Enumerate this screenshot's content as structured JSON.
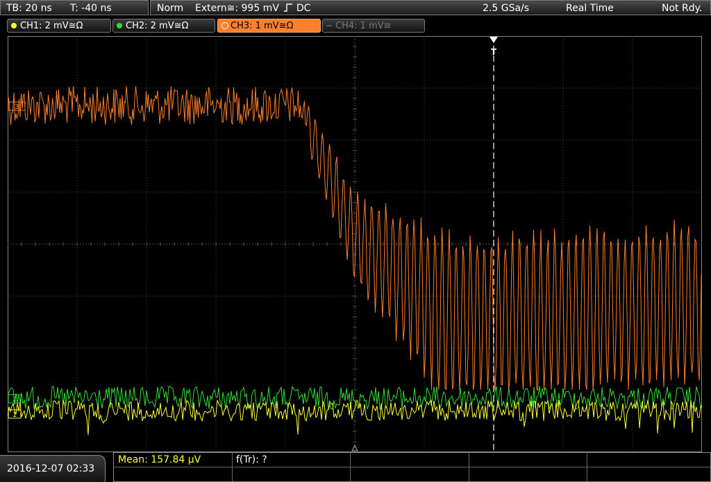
{
  "topbar": {
    "timebase": "TB: 20 ns",
    "trigger_time": "T: -40 ns",
    "mode": "Norm",
    "trigger_source": "Extern≅: 995 mV",
    "trigger_slope": "DC",
    "sample_rate": "2.5 GSa/s",
    "acq_mode": "Real Time",
    "status": "Not Rdy."
  },
  "channels": [
    {
      "label": "CH1: 2 mV≅Ω",
      "color": "#ffff33",
      "state": "on"
    },
    {
      "label": "CH2: 2 mV≅Ω",
      "color": "#33dd33",
      "state": "on"
    },
    {
      "label": "CH3: 1 mV≅Ω",
      "color": "#ff7f2a",
      "state": "active"
    },
    {
      "label": "CH4: 1 mV≅",
      "color": "#777777",
      "state": "off"
    }
  ],
  "screen": {
    "trigger_marker": "T",
    "ch3_marker": "3",
    "ch1_marker": "1",
    "ch2_marker": "2",
    "colors": {
      "grid": "#5a5a5a",
      "ch1": "#ffff33",
      "ch2": "#33dd33",
      "ch3": "#ff7f2a"
    }
  },
  "footer": {
    "datetime": "2016-12-07 02:33",
    "mean": "Mean: 157.84 µV",
    "ftr": "f(Tr): ?"
  }
}
